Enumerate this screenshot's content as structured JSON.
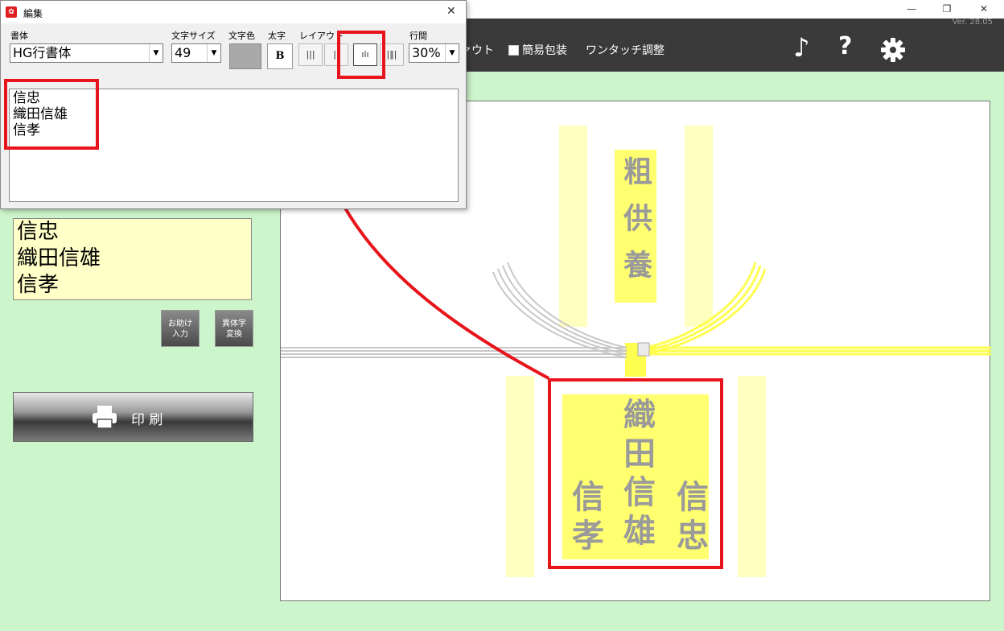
{
  "window": {
    "version": "Ver. 28.05",
    "minimize": "—",
    "restore": "❐",
    "close": "✕"
  },
  "toolbar": {
    "layout_label": "ァウト",
    "simple_wrap_label": "簡易包装",
    "one_touch_label": "ワンタッチ調整",
    "music_icon": "♪",
    "help_icon": "?",
    "settings_icon": "⚙"
  },
  "left_panel": {
    "name_lines": [
      "信忠",
      "織田信雄",
      "信孝"
    ],
    "helper_button": [
      "お助け",
      "入力"
    ],
    "variant_button": [
      "異体字",
      "変換"
    ],
    "print_label": "印 刷"
  },
  "canvas": {
    "title_chars": [
      "粗",
      "供",
      "養"
    ],
    "names_columns": [
      [
        "織",
        "田",
        "信",
        "雄"
      ],
      [
        "信",
        "孝"
      ],
      [
        "信",
        "忠"
      ]
    ],
    "colors": {
      "band": "#ffffc0",
      "highlight": "#ffff70",
      "gold": "#ffff50",
      "silver": "#c8c8c8",
      "text": "#9a9a9a"
    }
  },
  "dialog": {
    "title": "編集",
    "close": "✕",
    "font_label": "書体",
    "font_value": "HG行書体",
    "size_label": "文字サイズ",
    "size_value": "49",
    "color_label": "文字色",
    "bold_label": "太字",
    "bold_button": "B",
    "layout_label": "レイアウト",
    "spacing_label": "行間",
    "spacing_value": "30%",
    "text_lines": [
      "信忠",
      "織田信雄",
      "信孝"
    ]
  },
  "annotation_color": "#e8141c"
}
